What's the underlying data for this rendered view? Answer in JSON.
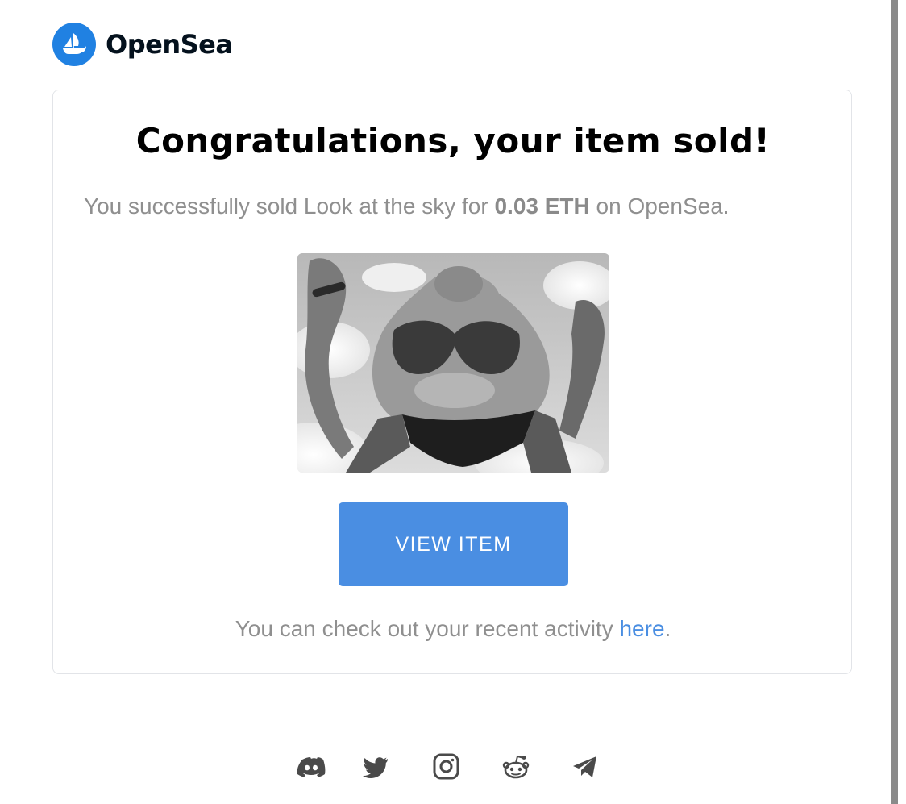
{
  "header": {
    "brand_name": "OpenSea",
    "logo_icon": "opensea-sailboat-icon"
  },
  "card": {
    "title": "Congratulations, your item sold!",
    "message_prefix": "You successfully sold Look at the sky for ",
    "price": "0.03 ETH",
    "message_suffix": " on OpenSea.",
    "artwork_icon": "item-artwork-image",
    "view_button_label": "VIEW ITEM",
    "activity_prefix": "You can check out your recent activity ",
    "activity_link": "here",
    "activity_suffix": "."
  },
  "social_icons": [
    "discord-icon",
    "twitter-icon",
    "instagram-icon",
    "reddit-icon",
    "telegram-icon"
  ],
  "colors": {
    "accent": "#4a8ee2",
    "brand_blue": "#2081e2",
    "text_gray": "#8f8f8f",
    "icon_gray": "#4a4a4a"
  }
}
